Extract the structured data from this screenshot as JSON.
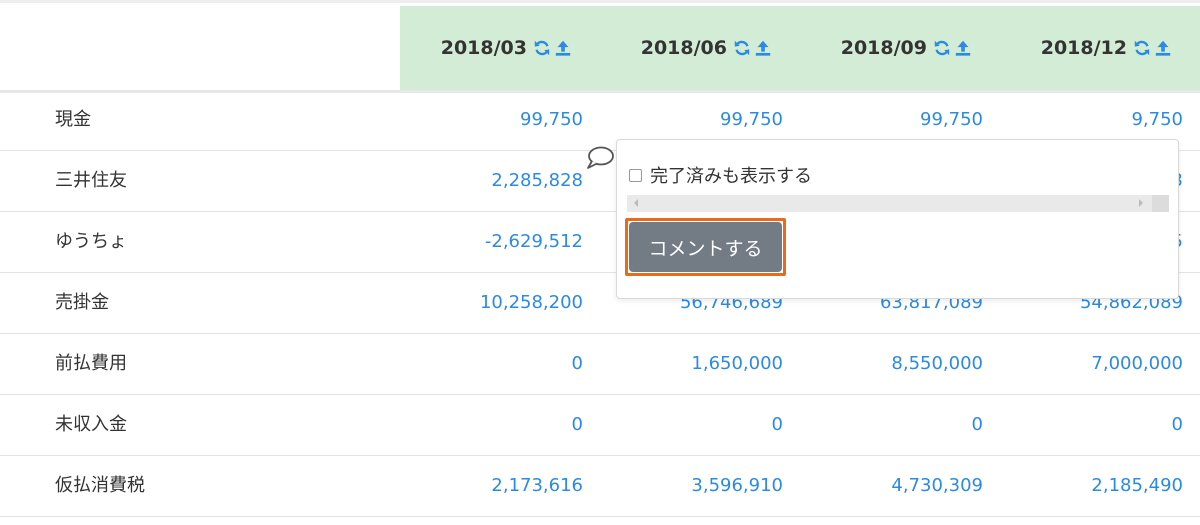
{
  "periods": [
    "2018/03",
    "2018/06",
    "2018/09",
    "2018/12"
  ],
  "rows": [
    {
      "label": "現金",
      "values": [
        "99,750",
        "99,750",
        "99,750",
        "9,750"
      ]
    },
    {
      "label": "三井住友",
      "values": [
        "2,285,828",
        "",
        "",
        "3"
      ]
    },
    {
      "label": "ゆうちょ",
      "values": [
        "-2,629,512",
        "",
        "",
        "5"
      ]
    },
    {
      "label": "売掛金",
      "values": [
        "10,258,200",
        "56,746,689",
        "63,817,089",
        "54,862,089"
      ]
    },
    {
      "label": "前払費用",
      "values": [
        "0",
        "1,650,000",
        "8,550,000",
        "7,000,000"
      ]
    },
    {
      "label": "未収入金",
      "values": [
        "0",
        "0",
        "0",
        "0"
      ]
    },
    {
      "label": "仮払消費税",
      "values": [
        "2,173,616",
        "3,596,910",
        "4,730,309",
        "2,185,490"
      ]
    }
  ],
  "popup": {
    "show_completed_label": "完了済みも表示する",
    "show_completed_checked": false,
    "comment_button_label": "コメントする"
  },
  "icons": {
    "refresh": "refresh-icon",
    "upload": "upload-icon",
    "comment": "speech-bubble-icon"
  },
  "colors": {
    "header_band": "#d3ecd5",
    "value_text": "#2b8ae3",
    "button_bg": "#737b85",
    "highlight_outline": "#ea6a18"
  }
}
